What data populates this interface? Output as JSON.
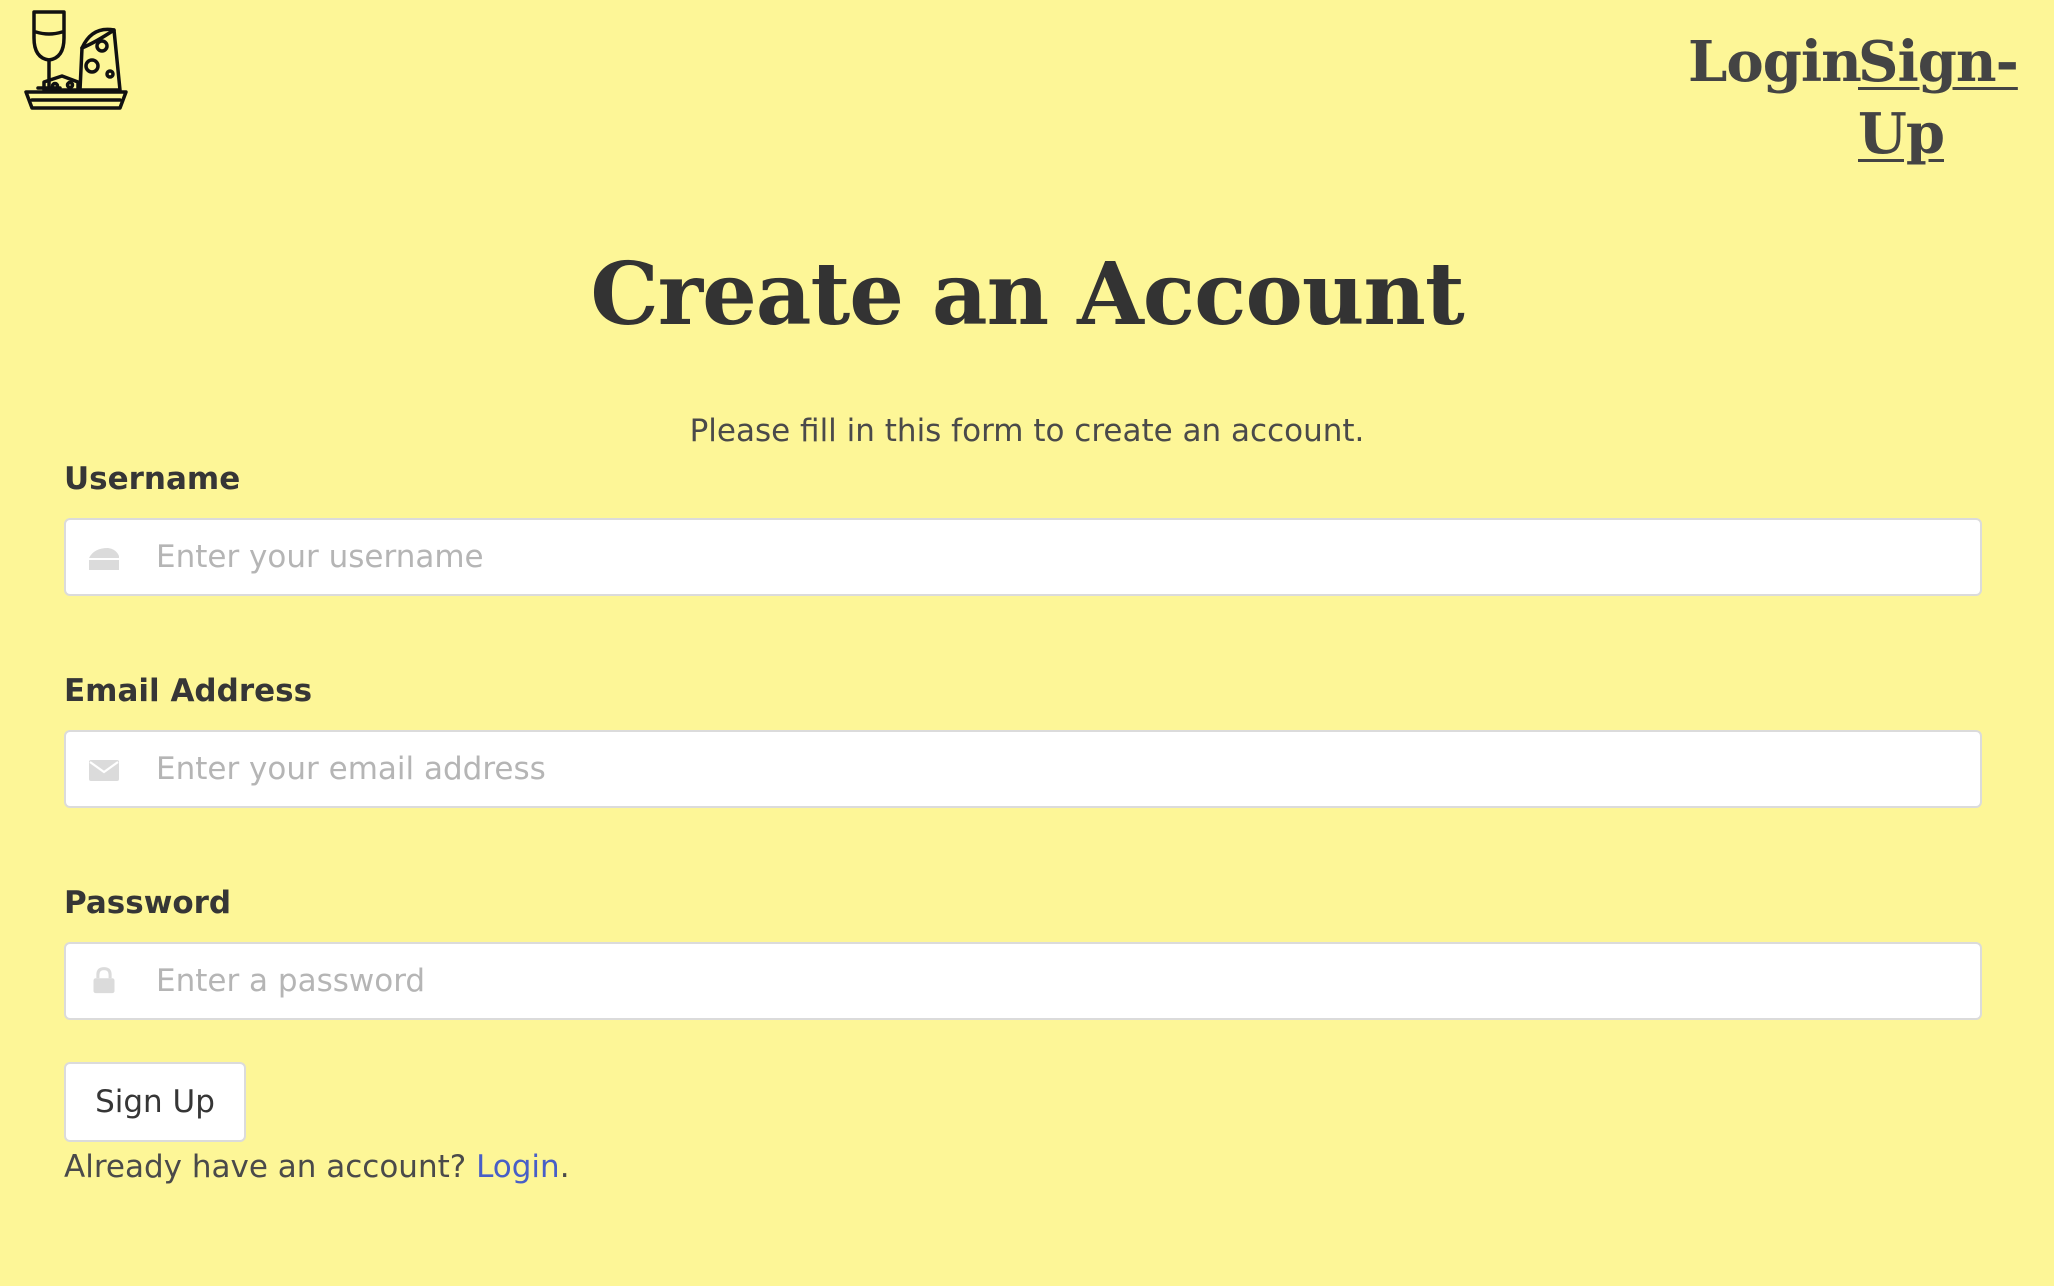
{
  "nav": {
    "logo_alt": "Wine and cheese logo",
    "login_label": "Login",
    "signup_label": "Sign-Up"
  },
  "page": {
    "title": "Create an Account",
    "subtitle": "Please fill in this form to create an account."
  },
  "form": {
    "username": {
      "label": "Username",
      "placeholder": "Enter your username",
      "value": "",
      "icon": "cheese-icon"
    },
    "email": {
      "label": "Email Address",
      "placeholder": "Enter your email address",
      "value": "",
      "icon": "envelope-icon"
    },
    "password": {
      "label": "Password",
      "placeholder": "Enter a password",
      "value": "",
      "icon": "lock-icon"
    },
    "submit_label": "Sign Up"
  },
  "footer_prompt": {
    "text": "Already have an account?",
    "link_label": "Login",
    "suffix": "."
  },
  "colors": {
    "background": "#fdf697",
    "link": "#485fc7",
    "icon": "#dbdbdb"
  }
}
